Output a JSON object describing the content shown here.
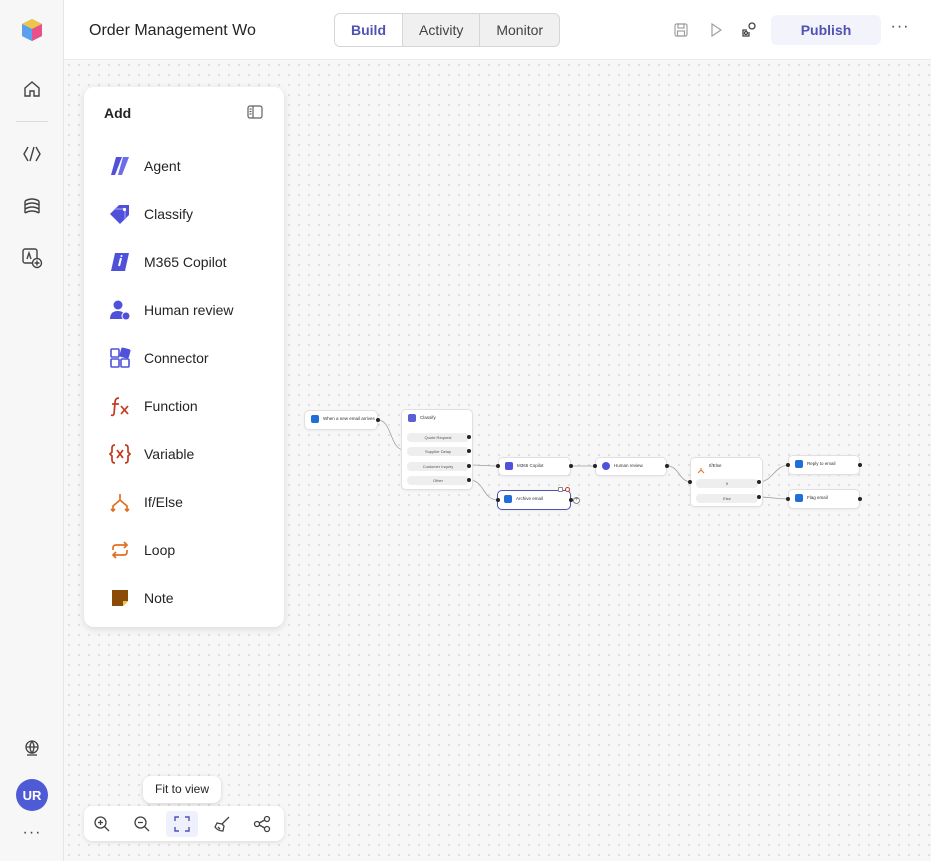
{
  "header": {
    "title": "Order Management Wo",
    "tabs": [
      {
        "label": "Build",
        "active": true
      },
      {
        "label": "Activity",
        "active": false
      },
      {
        "label": "Monitor",
        "active": false
      }
    ],
    "publish_label": "Publish"
  },
  "rail": {
    "avatar_initials": "UR",
    "more": "···"
  },
  "add_panel": {
    "title": "Add",
    "items": [
      {
        "label": "Agent",
        "icon": "agent-icon"
      },
      {
        "label": "Classify",
        "icon": "tag-icon"
      },
      {
        "label": "M365 Copilot",
        "icon": "copilot-icon"
      },
      {
        "label": "Human review",
        "icon": "person-icon"
      },
      {
        "label": "Connector",
        "icon": "connector-icon"
      },
      {
        "label": "Function",
        "icon": "function-icon"
      },
      {
        "label": "Variable",
        "icon": "variable-icon"
      },
      {
        "label": "If/Else",
        "icon": "branch-icon"
      },
      {
        "label": "Loop",
        "icon": "loop-icon"
      },
      {
        "label": "Note",
        "icon": "note-icon"
      }
    ]
  },
  "flow": {
    "trigger": "When a new email arrives",
    "classify": {
      "title": "Classify",
      "options": [
        "Quote Request",
        "Supplier Delay",
        "Customer Inquiry",
        "Other"
      ]
    },
    "archive": "Archive email",
    "copilot": "M365 Copilot",
    "human_review": "Human review",
    "ifelse": {
      "title": "If/Else",
      "branches": [
        "If",
        "Else"
      ]
    },
    "reply": "Reply to email",
    "flag": "Flag email"
  },
  "zoom_toolbar": {
    "tooltip": "Fit to view",
    "buttons": [
      "zoom-in-icon",
      "zoom-out-icon",
      "fit-view-icon",
      "broom-icon",
      "layout-icon"
    ]
  },
  "colors": {
    "accent": "#4f52b2",
    "avatar": "#4f5bd5",
    "function": "#c23a1d",
    "branch": "#e07020",
    "note": "#8a4b08"
  }
}
